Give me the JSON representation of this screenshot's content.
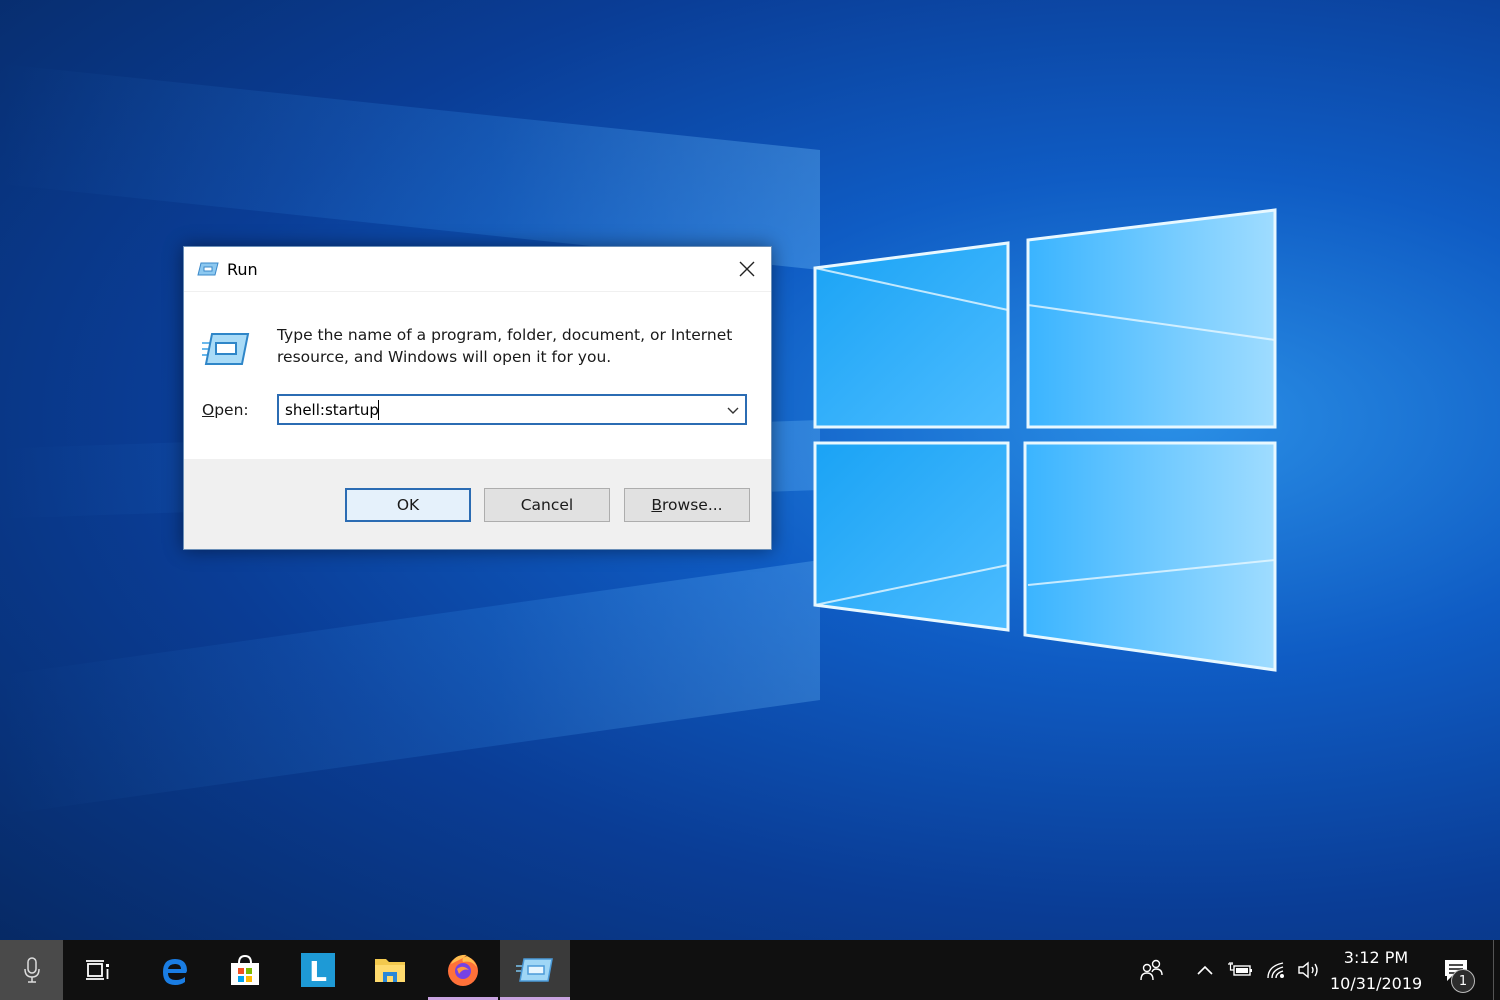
{
  "desktop": {
    "wallpaper": "windows-10-hero-light",
    "colors": {
      "wallpaper_dark": "#06275e",
      "wallpaper_mid": "#0f5cc4",
      "logo_light": "#5cc8ff"
    }
  },
  "run_dialog": {
    "title": "Run",
    "icon": "run-icon",
    "description": "Type the name of a program, folder, document, or Internet resource, and Windows will open it for you.",
    "open_label_accel": "O",
    "open_label_rest": "pen:",
    "open_value": "shell:startup",
    "buttons": {
      "ok": "OK",
      "cancel": "Cancel",
      "browse_accel": "B",
      "browse_rest": "rowse..."
    },
    "colors": {
      "focus_border": "#2b6cb3",
      "footer_bg": "#f0f0f0"
    }
  },
  "taskbar": {
    "items": [
      {
        "name": "microphone",
        "icon": "microphone-icon"
      },
      {
        "name": "task-view",
        "icon": "task-view-icon"
      },
      {
        "name": "edge",
        "icon": "edge-icon"
      },
      {
        "name": "store",
        "icon": "store-icon"
      },
      {
        "name": "app-l",
        "icon": "l-app-icon",
        "label": "L"
      },
      {
        "name": "file-explorer",
        "icon": "folder-icon"
      },
      {
        "name": "firefox",
        "icon": "firefox-icon"
      },
      {
        "name": "run",
        "icon": "run-icon"
      }
    ],
    "tray": {
      "people_icon": "people-icon",
      "overflow_icon": "chevron-up-icon",
      "battery_icon": "battery-charging-icon",
      "network_icon": "wifi-icon",
      "volume_icon": "volume-icon",
      "time": "3:12 PM",
      "date": "10/31/2019",
      "notifications_icon": "action-center-icon",
      "notification_count": "1"
    }
  }
}
